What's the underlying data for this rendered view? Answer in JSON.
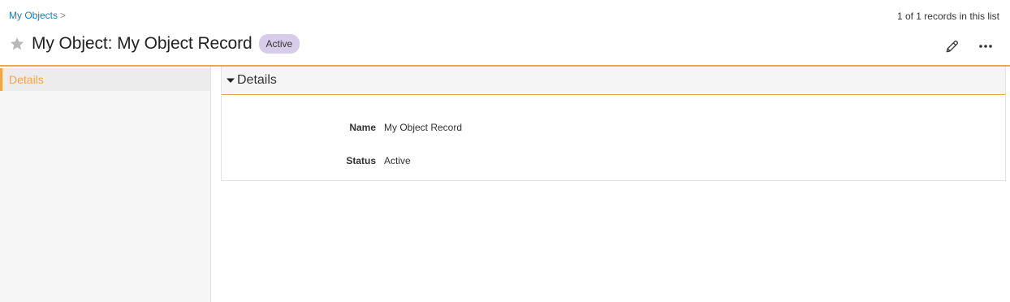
{
  "breadcrumb": {
    "link": "My Objects",
    "separator": ">"
  },
  "records_text": "1 of 1 records in this list",
  "header": {
    "title": "My Object: My Object Record",
    "status_badge": "Active"
  },
  "icons": {
    "favorite": "star-icon",
    "edit": "pencil-icon",
    "more": "more-dots-icon",
    "collapse": "caret-down-icon"
  },
  "colors": {
    "accent": "#f0a54a",
    "link": "#1a7fbf",
    "badge_bg": "#d7cdea"
  },
  "sidebar": {
    "items": [
      {
        "label": "Details",
        "selected": true
      }
    ]
  },
  "details": {
    "title": "Details",
    "fields": [
      {
        "label": "Name",
        "value": "My Object Record"
      },
      {
        "label": "Status",
        "value": "Active"
      }
    ]
  }
}
